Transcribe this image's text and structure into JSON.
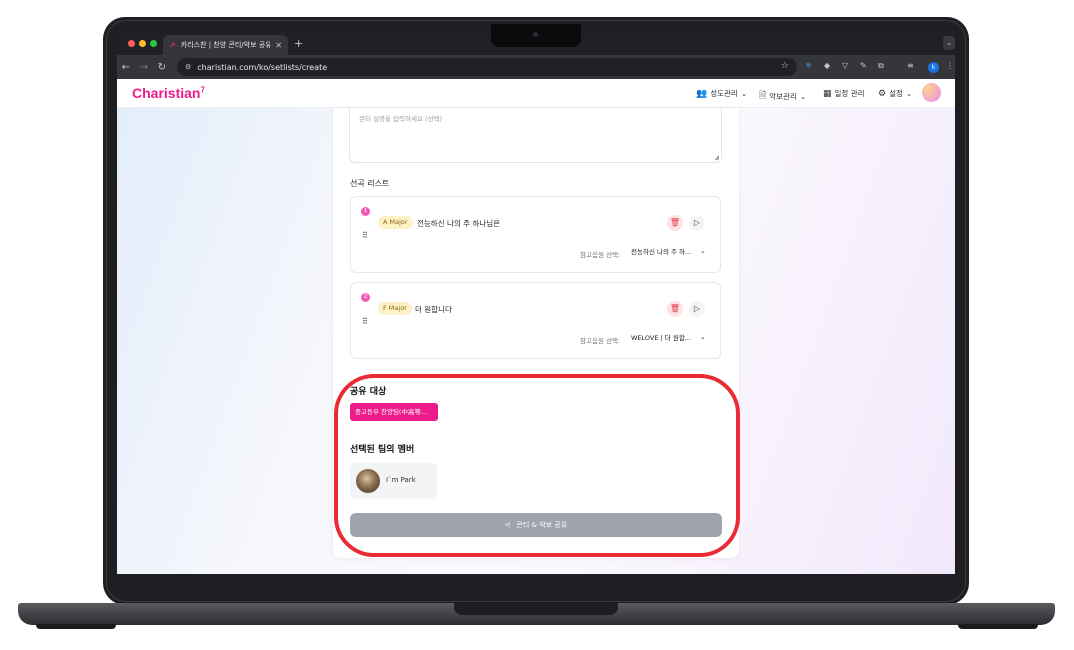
{
  "browser": {
    "tab_title": "카리스찬 | 찬양 콘티/악보 공유 플...",
    "url": "charistian.com/ko/setlists/create",
    "profile_initial": "k"
  },
  "app": {
    "logo": "Charistian",
    "logo_mark": "7",
    "nav": {
      "members": "성도관리",
      "scores": "악보관리",
      "schedule": "일정 관리",
      "settings": "설정"
    }
  },
  "form": {
    "description_placeholder": "콘티 설명을 입력하세요 (선택)",
    "song_list_label": "선곡 리스트",
    "reference_label": "참고음원 선택:",
    "songs": [
      {
        "number": "1",
        "key": "A Major",
        "title": "전능하신 나의 주 하나님은",
        "reference": "전능하신 나의 주 하..."
      },
      {
        "number": "2",
        "key": "F Major",
        "title": "더 원합니다",
        "reference": "WELOVE | 더 원합..."
      }
    ],
    "share_target_title": "공유 대상",
    "share_target_tag": "중고등부 찬양팀(中高等...",
    "members_title": "선택된 팀의 멤버",
    "members": [
      {
        "name": "I`m Park"
      }
    ],
    "share_button": "콘티 & 악보 공유"
  },
  "colors": {
    "brand": "#ec1d8a",
    "highlight": "#ea2a34"
  }
}
